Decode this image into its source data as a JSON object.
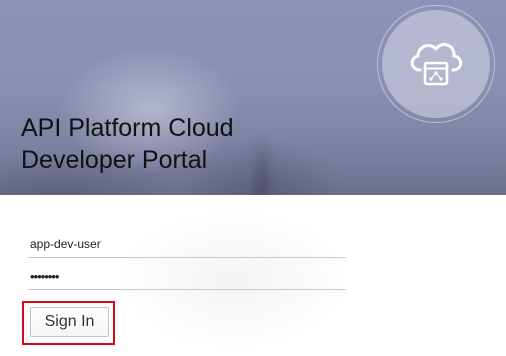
{
  "header": {
    "title_line1": "API Platform Cloud",
    "title_line2": "Developer Portal",
    "logo_icon": "cloud-api-icon"
  },
  "login": {
    "username_value": "app-dev-user",
    "password_value": "••••••••",
    "signin_label": "Sign In"
  },
  "colors": {
    "highlight": "#d9091a",
    "header_bg": "#8a8fb1"
  }
}
